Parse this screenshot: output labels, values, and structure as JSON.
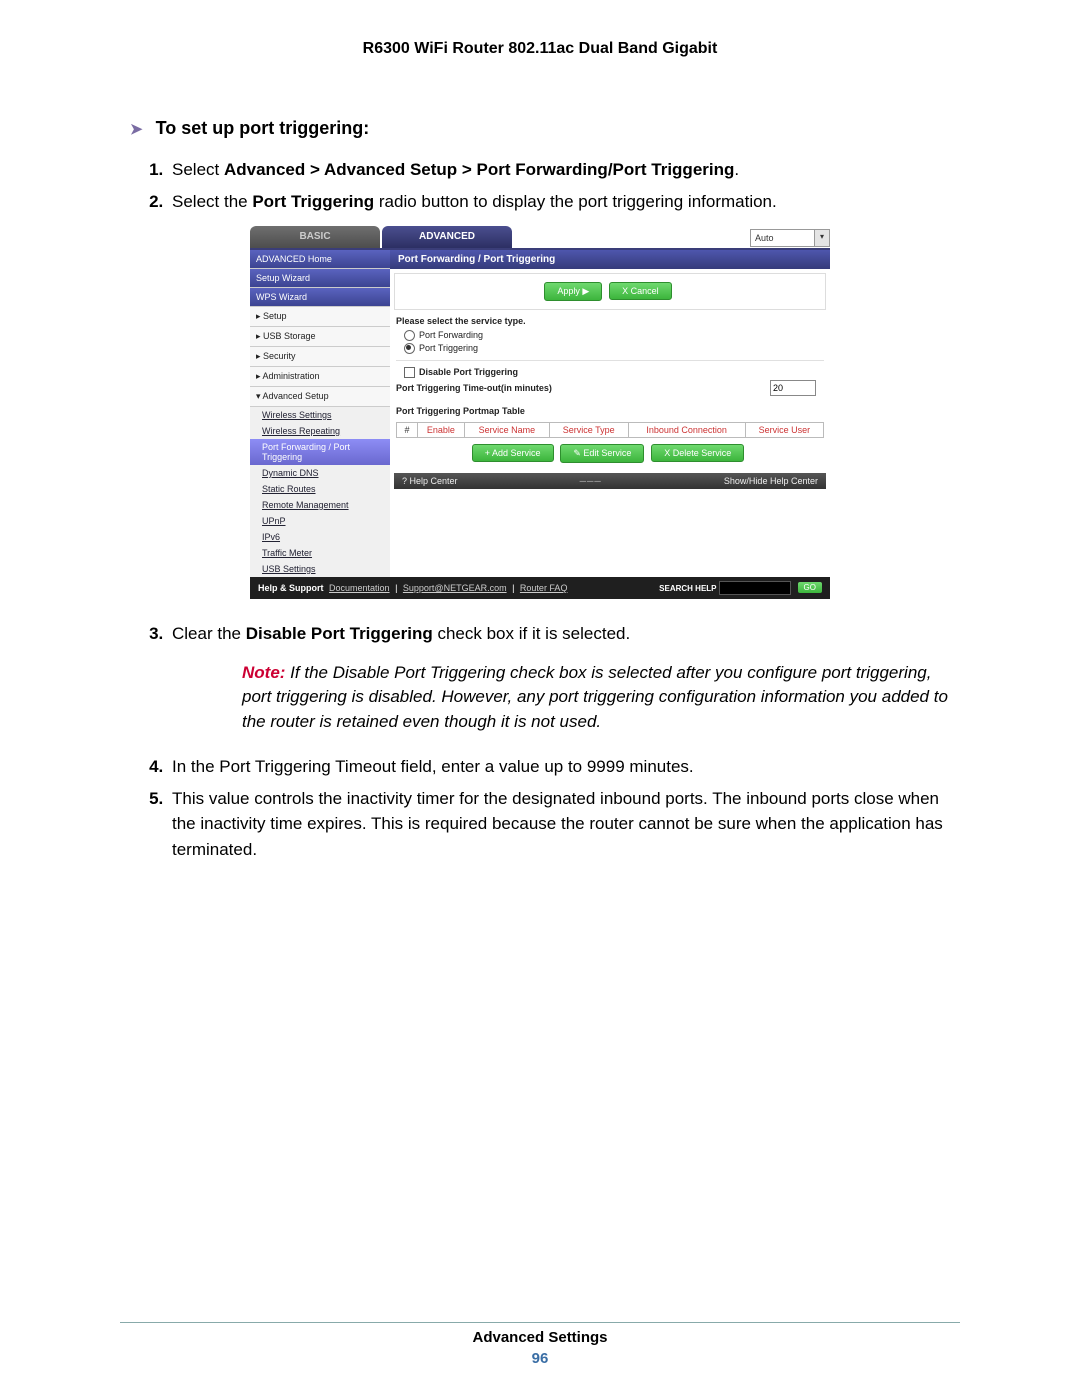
{
  "doc_header": "R6300 WiFi Router 802.11ac Dual Band Gigabit",
  "section_heading": "To set up port triggering:",
  "steps": {
    "s1_a": "Select ",
    "s1_b": "Advanced > Advanced Setup > Port Forwarding/Port Triggering",
    "s1_c": ".",
    "s2_a": "Select the ",
    "s2_b": "Port Triggering",
    "s2_c": " radio button to display the port triggering information.",
    "s3_a": "Clear the ",
    "s3_b": "Disable Port Triggering",
    "s3_c": " check box if it is selected.",
    "s4": "In the Port Triggering Timeout field, enter a value up to 9999 minutes.",
    "s5": "This value controls the inactivity timer for the designated inbound ports. The inbound ports close when the inactivity time expires. This is required because the router cannot be sure when the application has terminated."
  },
  "note": {
    "label": "Note:",
    "text": "  If the Disable Port Triggering check box is selected after you configure port triggering, port triggering is disabled. However, any port triggering configuration information you added to the router is retained even though it is not used."
  },
  "ui": {
    "tabs": {
      "basic": "BASIC",
      "advanced": "ADVANCED",
      "auto": "Auto"
    },
    "sidebar": {
      "top": [
        "ADVANCED Home",
        "Setup Wizard",
        "WPS Wizard"
      ],
      "menu": [
        "Setup",
        "USB Storage",
        "Security",
        "Administration",
        "Advanced Setup"
      ],
      "sub": [
        "Wireless Settings",
        "Wireless Repeating",
        "Port Forwarding / Port Triggering",
        "Dynamic DNS",
        "Static Routes",
        "Remote Management",
        "UPnP",
        "IPv6",
        "Traffic Meter",
        "USB Settings"
      ]
    },
    "content": {
      "title": "Port Forwarding / Port Triggering",
      "apply": "Apply ▶",
      "cancel": "X Cancel",
      "select_type": "Please select the service type.",
      "rb_forward": "Port Forwarding",
      "rb_trigger": "Port Triggering",
      "cb_disable": "Disable Port Triggering",
      "timeout_label": "Port Triggering Time-out(in minutes)",
      "timeout_value": "20",
      "portmap_title": "Port Triggering Portmap Table",
      "cols": [
        "#",
        "Enable",
        "Service Name",
        "Service Type",
        "Inbound Connection",
        "Service User"
      ],
      "add": "+ Add Service",
      "edit": "✎ Edit Service",
      "del": "X Delete Service",
      "help_center": "Help Center",
      "showhide": "Show/Hide Help Center",
      "qmark": "?"
    },
    "support": {
      "label": "Help & Support",
      "links": [
        "Documentation",
        "Support@NETGEAR.com",
        "Router FAQ"
      ],
      "search_label": "SEARCH HELP",
      "go": "GO"
    }
  },
  "footer": {
    "title": "Advanced Settings",
    "page": "96"
  }
}
